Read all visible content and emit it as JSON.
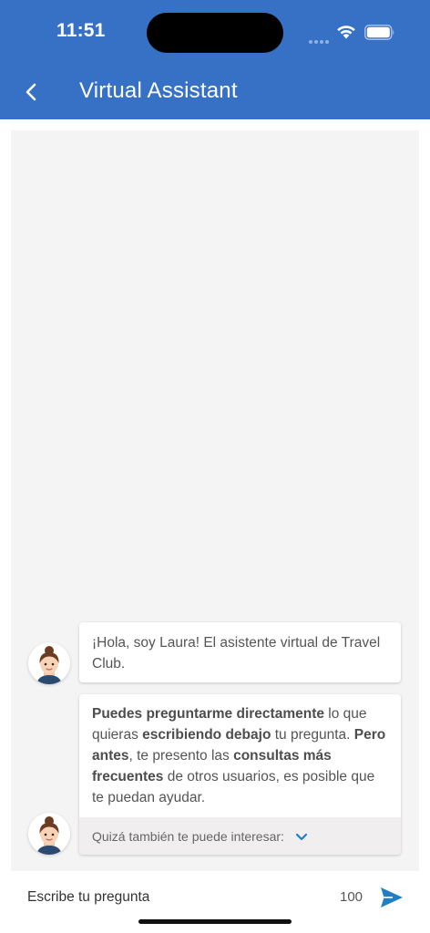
{
  "status_bar": {
    "time": "11:51"
  },
  "header": {
    "title": "Virtual Assistant",
    "back_icon": "chevron-left-icon"
  },
  "messages": [
    {
      "sender": "Laura",
      "text": "¡Hola, soy Laura! El asistente virtual de Travel Club."
    },
    {
      "sender": "Laura",
      "parts": [
        {
          "text": "Puedes preguntarme directamente",
          "bold": true
        },
        {
          "text": " lo que quieras ",
          "bold": false
        },
        {
          "text": "escribiendo debajo",
          "bold": true
        },
        {
          "text": " tu pregunta. ",
          "bold": false
        },
        {
          "text": "Pero antes",
          "bold": true
        },
        {
          "text": ", te presento las ",
          "bold": false
        },
        {
          "text": "consultas más frecuentes",
          "bold": true
        },
        {
          "text": " de otros usuarios, es posible que te puedan ayudar.",
          "bold": false
        }
      ],
      "suggestion_label": "Quizá también te puede interesar:"
    }
  ],
  "composer": {
    "placeholder": "Escribe tu pregunta",
    "char_counter": "100",
    "send_icon": "send-icon"
  },
  "colors": {
    "header_bg": "#3671c6",
    "chat_bg": "#f4f4f4",
    "accent": "#1f7fc4"
  }
}
